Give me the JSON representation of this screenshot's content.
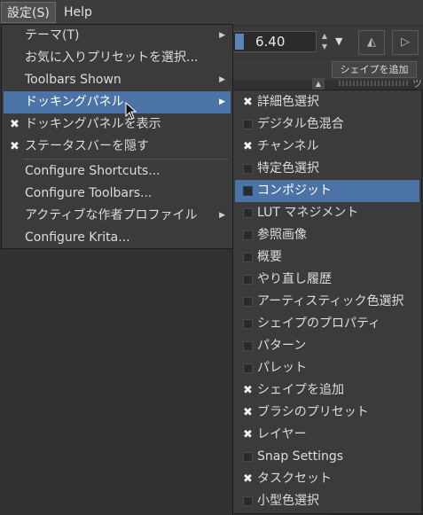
{
  "menubar": {
    "settings": "設定(S)",
    "help": "Help"
  },
  "toolbar": {
    "brush_size": "6.40"
  },
  "shapes_panel": {
    "add_shape_button": "シェイプを追加",
    "right_text": "ツ"
  },
  "settings_menu": {
    "items": [
      {
        "label": "テーマ(T)",
        "submenu": true
      },
      {
        "label": "お気に入りプリセットを選択..."
      },
      {
        "label": "Toolbars Shown",
        "submenu": true
      },
      {
        "label": "ドッキングパネル",
        "submenu": true,
        "highlighted": true
      },
      {
        "label": "ドッキングパネルを表示",
        "checked": true
      },
      {
        "label": "ステータスバーを隠す",
        "checked": true
      },
      {
        "label": "Configure Shortcuts..."
      },
      {
        "label": "Configure Toolbars..."
      },
      {
        "label": "アクティブな作者プロファイル",
        "submenu": true
      },
      {
        "label": "Configure Krita..."
      }
    ]
  },
  "dockers_menu": {
    "items": [
      {
        "label": "詳細色選択",
        "checked": true
      },
      {
        "label": "デジタル色混合",
        "checked": false
      },
      {
        "label": "チャンネル",
        "checked": true
      },
      {
        "label": "特定色選択",
        "checked": false
      },
      {
        "label": "コンポジット",
        "checked": false,
        "highlighted": true
      },
      {
        "label": "LUT マネジメント",
        "checked": false
      },
      {
        "label": "参照画像",
        "checked": false
      },
      {
        "label": "概要",
        "checked": false
      },
      {
        "label": "やり直し履歴",
        "checked": false
      },
      {
        "label": "アーティスティック色選択",
        "checked": false
      },
      {
        "label": "シェイプのプロパティ",
        "checked": false
      },
      {
        "label": "パターン",
        "checked": false
      },
      {
        "label": "パレット",
        "checked": false
      },
      {
        "label": "シェイプを追加",
        "checked": true
      },
      {
        "label": "ブラシのプリセット",
        "checked": true
      },
      {
        "label": "レイヤー",
        "checked": true
      },
      {
        "label": "Snap Settings",
        "checked": false
      },
      {
        "label": "タスクセット",
        "checked": true
      },
      {
        "label": "小型色選択",
        "checked": false
      }
    ]
  },
  "colors": {
    "highlight": "#4c73a5",
    "menu_bg": "#3b3b3b",
    "app_bg": "#313131"
  }
}
